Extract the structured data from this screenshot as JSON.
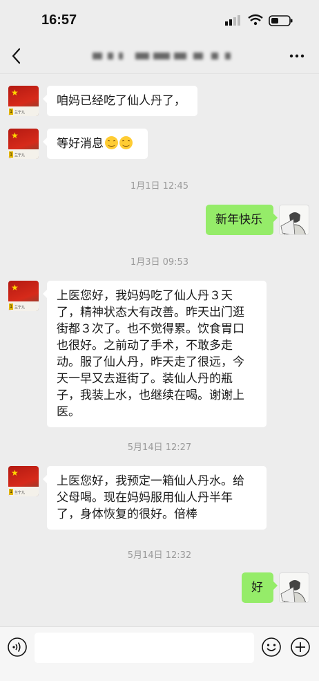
{
  "status_bar": {
    "time": "16:57"
  },
  "chat": {
    "title": "",
    "input_placeholder": ""
  },
  "contact": {
    "avatar_caption": "兰宁儿"
  },
  "messages": [
    {
      "side": "left",
      "text": "咱妈已经吃了仙人丹了，"
    },
    {
      "side": "left",
      "text": "等好消息",
      "emoji_count": 2
    },
    {
      "type": "time",
      "text": "1月1日 12:45"
    },
    {
      "side": "right",
      "text": "新年快乐"
    },
    {
      "type": "time",
      "text": "1月3日 09:53"
    },
    {
      "side": "left",
      "lines": [
        "上医您好，我妈妈吃了仙人丹３天",
        "了，精神状态大有改善。昨天出门逛",
        "街都３次了。也不觉得累。饮食胃口",
        "也很好。之前动了手术，不敢多走",
        "动。服了仙人丹，昨天走了很远，今",
        "天一早又去逛街了。装仙人丹的瓶",
        "子，我装上水，也继续在喝。谢谢上",
        "医。"
      ]
    },
    {
      "type": "time",
      "text": "5月14日 12:27"
    },
    {
      "side": "left",
      "lines": [
        "上医您好，我预定一箱仙人丹水。给",
        "父母喝。现在妈妈服用仙人丹半年",
        "了，身体恢复的很好。倍棒"
      ]
    },
    {
      "type": "time",
      "text": "5月14日 12:32"
    },
    {
      "side": "right",
      "text": "好"
    }
  ],
  "colors": {
    "background": "#ededed",
    "bubble_in": "#ffffff",
    "bubble_out": "#95ec69",
    "timestamp": "#9a9a9a"
  },
  "icons": {
    "back": "chevron-left-icon",
    "more": "more-dots-icon",
    "voice": "voice-icon",
    "emoji": "emoji-icon",
    "add": "plus-circle-icon"
  }
}
